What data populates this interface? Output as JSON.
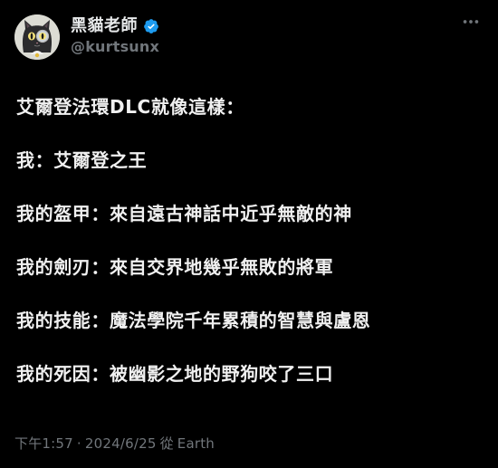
{
  "author": {
    "display_name": "黑貓老師",
    "handle": "@kurtsunx",
    "avatar_icon": "black-cat-avatar-icon",
    "verified_icon": "verified-badge-icon",
    "verified_color": "#1d9bf0"
  },
  "post": {
    "lines": [
      "艾爾登法環DLC就像這樣：",
      "我：艾爾登之王",
      "我的盔甲：來自遠古神話中近乎無敵的神",
      "我的劍刃：來自交界地幾乎無敗的將軍",
      "我的技能：魔法學院千年累積的智慧與盧恩",
      "我的死因：被幽影之地的野狗咬了三口"
    ]
  },
  "meta": {
    "time": "下午1:57",
    "separator": "·",
    "date": "2024/6/25",
    "from_label": "從",
    "source": "Earth"
  },
  "actions": {
    "more_icon": "more-horizontal-icon"
  },
  "colors": {
    "background": "#000000",
    "text_primary": "#e7e9ea",
    "text_secondary": "#71767b",
    "accent": "#1d9bf0"
  }
}
